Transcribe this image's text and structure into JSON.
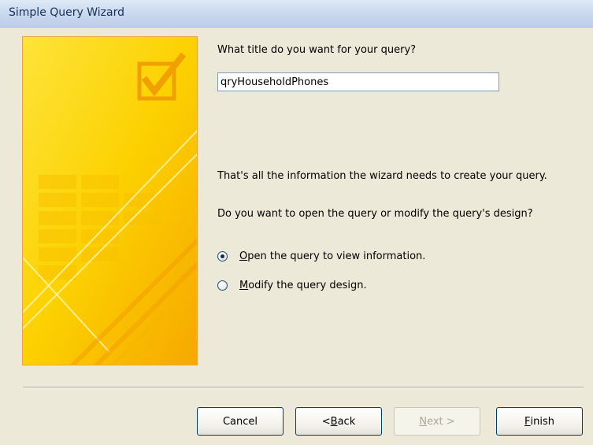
{
  "window": {
    "title": "Simple Query Wizard"
  },
  "prompt": {
    "question": "What title do you want for your query?",
    "title_value": "qryHouseholdPhones"
  },
  "info": {
    "line1": "That's all the information the wizard needs to create your query.",
    "line2": "Do you want to open the query or modify the query's design?"
  },
  "options": {
    "open": {
      "accel": "O",
      "rest": "pen the query to view information.",
      "checked": true
    },
    "modify": {
      "accel": "M",
      "rest": "odify the query design.",
      "checked": false
    }
  },
  "buttons": {
    "cancel": "Cancel",
    "back_prefix": "< ",
    "back_accel": "B",
    "back_rest": "ack",
    "next_accel": "N",
    "next_rest": "ext >",
    "finish_accel": "F",
    "finish_rest": "inish"
  },
  "colors": {
    "art_yellow": "#fcd400",
    "art_orange": "#f5a400",
    "art_border": "#e6a640"
  },
  "icons": {
    "art": "checkbox-check-icon"
  }
}
